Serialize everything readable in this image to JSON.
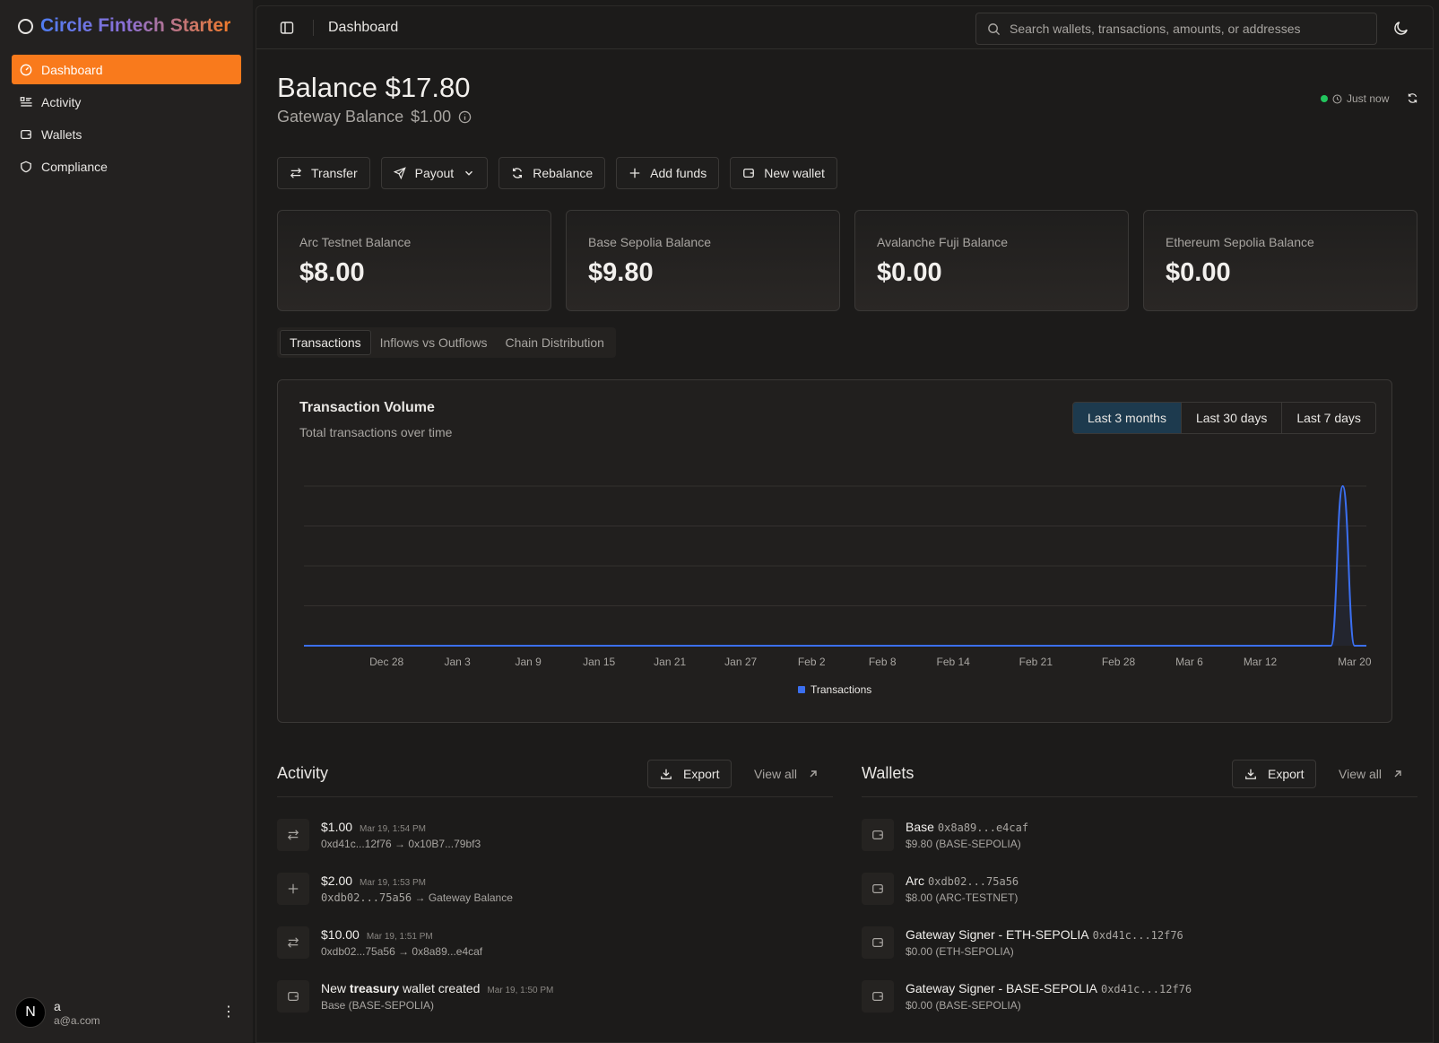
{
  "brand": {
    "title": "Circle Fintech Starter"
  },
  "sidebar": {
    "items": [
      {
        "label": "Dashboard",
        "icon": "dashboard-icon",
        "active": true
      },
      {
        "label": "Activity",
        "icon": "activity-list-icon"
      },
      {
        "label": "Wallets",
        "icon": "wallet-icon"
      },
      {
        "label": "Compliance",
        "icon": "shield-icon"
      }
    ],
    "user": {
      "initial": "N",
      "name": "a",
      "email": "a@a.com"
    }
  },
  "header": {
    "title": "Dashboard",
    "search_placeholder": "Search wallets, transactions, amounts, or addresses"
  },
  "balance": {
    "title": "Balance $17.80",
    "gateway_label": "Gateway Balance",
    "gateway_value": "$1.00",
    "status": "Just now",
    "status_color": "#22c55e"
  },
  "actions": {
    "transfer": "Transfer",
    "payout": "Payout",
    "rebalance": "Rebalance",
    "add_funds": "Add funds",
    "new_wallet": "New wallet"
  },
  "cards": [
    {
      "label": "Arc Testnet Balance",
      "value": "$8.00"
    },
    {
      "label": "Base Sepolia Balance",
      "value": "$9.80"
    },
    {
      "label": "Avalanche Fuji Balance",
      "value": "$0.00"
    },
    {
      "label": "Ethereum Sepolia Balance",
      "value": "$0.00"
    }
  ],
  "tabs": [
    "Transactions",
    "Inflows vs Outflows",
    "Chain Distribution"
  ],
  "chart": {
    "title": "Transaction Volume",
    "subtitle": "Total transactions over time",
    "ranges": [
      "Last 3 months",
      "Last 30 days",
      "Last 7 days"
    ],
    "selected_range": "Last 3 months",
    "accent": "#3b6ff0"
  },
  "chart_data": {
    "type": "area",
    "title": "Transaction Volume",
    "subtitle": "Total transactions over time",
    "x_ticks": [
      "Dec 28",
      "Jan 3",
      "Jan 9",
      "Jan 15",
      "Jan 21",
      "Jan 27",
      "Feb 2",
      "Feb 8",
      "Feb 14",
      "Feb 21",
      "Feb 28",
      "Mar 6",
      "Mar 12",
      "Mar 20"
    ],
    "series": [
      {
        "name": "Transactions",
        "x": [
          "Dec 21",
          "Mar 17",
          "Mar 18",
          "Mar 19",
          "Mar 20",
          "Mar 21"
        ],
        "values": [
          0,
          0,
          0,
          4,
          0,
          0
        ]
      }
    ],
    "ylim": [
      0,
      4
    ],
    "grid": true,
    "legend": "bottom-center",
    "y_tick_labels_shown": false
  },
  "activity": {
    "title": "Activity",
    "export": "Export",
    "view_all": "View all",
    "items": [
      {
        "icon": "transfer-arrows-icon",
        "amount": "$1.00",
        "time": "Mar 19, 1:54 PM",
        "detail": "0xd41c...12f76 → 0x10B7...79bf3",
        "mono": false
      },
      {
        "icon": "plus-icon",
        "amount": "$2.00",
        "time": "Mar 19, 1:53 PM",
        "detail_mono": "0xdb02...75a56",
        "detail_rest": " → Gateway Balance",
        "mono": true
      },
      {
        "icon": "transfer-arrows-icon",
        "amount": "$10.00",
        "time": "Mar 19, 1:51 PM",
        "detail": "0xdb02...75a56 → 0x8a89...e4caf",
        "mono": false
      },
      {
        "icon": "wallet-icon",
        "pre": "New ",
        "bold": "treasury",
        "post": " wallet created",
        "time": "Mar 19, 1:50 PM",
        "detail": "Base (BASE-SEPOLIA)"
      }
    ]
  },
  "wallets": {
    "title": "Wallets",
    "export": "Export",
    "view_all": "View all",
    "items": [
      {
        "name": "Base",
        "address": "0x8a89...e4caf",
        "detail": "$9.80 (BASE-SEPOLIA)"
      },
      {
        "name": "Arc",
        "address": "0xdb02...75a56",
        "detail": "$8.00 (ARC-TESTNET)"
      },
      {
        "name": "Gateway Signer - ETH-SEPOLIA",
        "address": "0xd41c...12f76",
        "detail": "$0.00 (ETH-SEPOLIA)"
      },
      {
        "name": "Gateway Signer - BASE-SEPOLIA",
        "address": "0xd41c...12f76",
        "detail": "$0.00 (BASE-SEPOLIA)"
      }
    ]
  }
}
